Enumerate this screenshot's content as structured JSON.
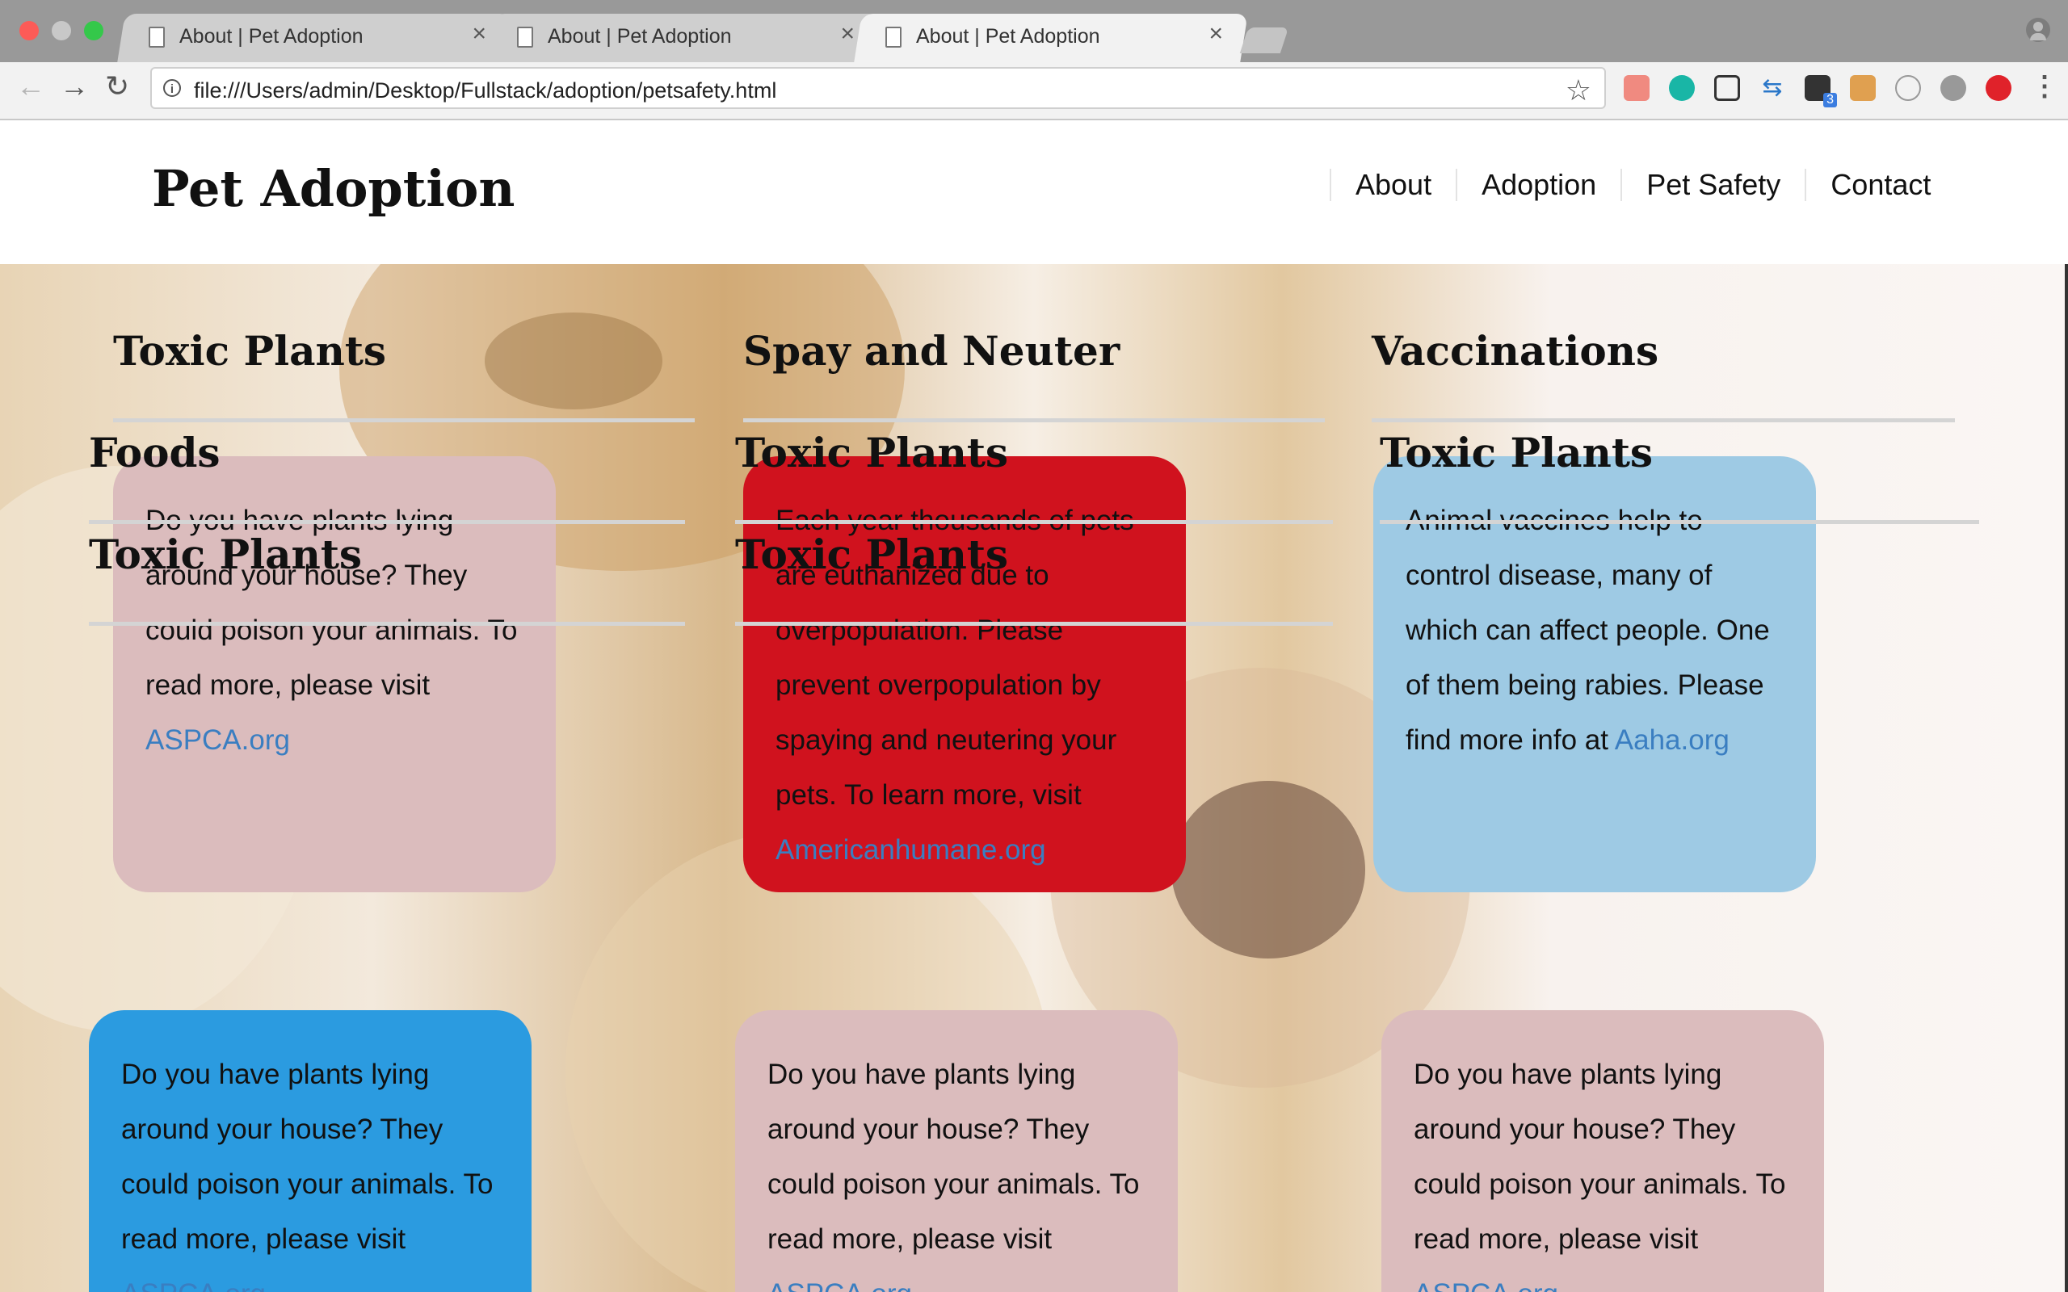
{
  "browser": {
    "tabs": [
      {
        "title": "About | Pet Adoption",
        "active": false
      },
      {
        "title": "About | Pet Adoption",
        "active": false
      },
      {
        "title": "About | Pet Adoption",
        "active": true
      }
    ],
    "tab_close_glyph": "×",
    "url": "file:///Users/admin/Desktop/Fullstack/adoption/petsafety.html",
    "extension_badge": "3"
  },
  "site": {
    "brand": "Pet Adoption",
    "nav": [
      "About",
      "Adoption",
      "Pet Safety",
      "Contact"
    ]
  },
  "sections": {
    "col1_title": "Toxic Plants",
    "col2_title": "Spay and Neuter",
    "col3_title": "Vaccinations",
    "overlap_col1_a": "Foods",
    "overlap_col1_b": "Toxic Plants",
    "overlap_col2_a": "Toxic Plants",
    "overlap_col2_b": "Toxic Plants",
    "overlap_col3_a": "Toxic Plants"
  },
  "cards": {
    "toxic": {
      "text": "Do you have plants lying around your house? They could poison your animals. To read more, please visit ",
      "link": "ASPCA.org",
      "color": "#dbbcbd"
    },
    "spay": {
      "text": "Each year thousands of pets are euthanized due to overpopulation. Please prevent overpopulation by spaying and neutering your pets. To learn more, visit ",
      "link": "Americanhumane.org",
      "color": "#d0121e"
    },
    "vacc": {
      "text": "Animal vaccines help to control disease, many of which can affect people. One of them being rabies. Please find more info at ",
      "link": "Aaha.org",
      "color": "#9ecae4"
    },
    "bottom1": {
      "text": "Do you have plants lying around your house? They could poison your animals. To read more, please visit ",
      "link": "ASPCA.org",
      "color": "#2b9be0"
    },
    "bottom2": {
      "text": "Do you have plants lying around your house? They could poison your animals. To read more, please visit ",
      "link": "ASPCA.org",
      "color": "#dbbcbd"
    },
    "bottom3": {
      "text": "Do you have plants lying around your house? They could poison your animals. To read more, please visit ",
      "link": "ASPCA.org",
      "color": "#dbbcbd"
    }
  }
}
